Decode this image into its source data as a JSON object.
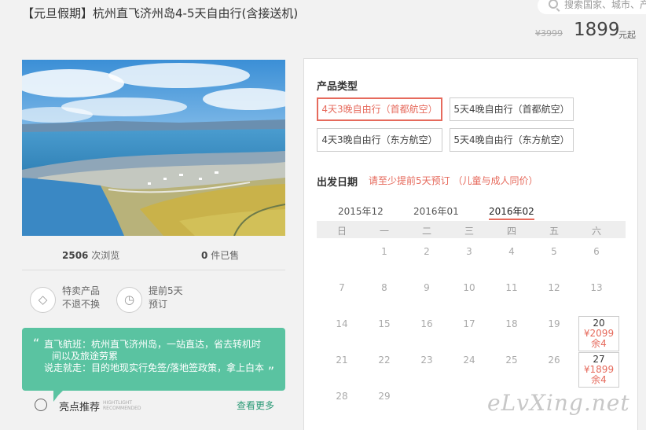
{
  "header": {
    "title": "【元旦假期】杭州直飞济州岛4-5天自由行(含接送机)",
    "search_placeholder": "搜索国家、城市、产",
    "old_price": "¥3999",
    "price": "1899",
    "price_unit": "元起"
  },
  "stats": {
    "views_count": "2506",
    "views_label": "次浏览",
    "sold_count": "0",
    "sold_label": "件已售"
  },
  "features": [
    {
      "icon": "tag-icon",
      "line1": "特卖产品",
      "line2": "不退不换"
    },
    {
      "icon": "clock-icon",
      "line1": "提前5天",
      "line2": "预订"
    }
  ],
  "highlight_box": {
    "line1": "直飞航班：杭州直飞济州岛，一站直达，省去转机时",
    "line2": "间以及旅途劳累",
    "line3": "说走就走：目的地现实行免签/落地签政策，拿上白本"
  },
  "highlight": {
    "label": "亮点推荐",
    "label_en_1": "HIGHTLIGHT",
    "label_en_2": "RECOMMENDED",
    "more": "查看更多"
  },
  "product": {
    "title": "产品类型",
    "options": [
      "4天3晚自由行（首都航空）",
      "5天4晚自由行（首都航空）",
      "4天3晚自由行（东方航空）",
      "5天4晚自由行（东方航空）"
    ]
  },
  "departure": {
    "title": "出发日期",
    "notice": "请至少提前5天预订 （儿童与成人同价）",
    "months": [
      "2015年12",
      "2016年01",
      "2016年02"
    ],
    "weekdays": [
      "日",
      "一",
      "二",
      "三",
      "四",
      "五",
      "六"
    ],
    "days": [
      "1",
      "2",
      "3",
      "4",
      "5",
      "6",
      "7",
      "8",
      "9",
      "10",
      "11",
      "12",
      "13",
      "14",
      "15",
      "16",
      "17",
      "18",
      "19",
      "21",
      "22",
      "23",
      "24",
      "25",
      "26",
      "28",
      "29"
    ],
    "priced": [
      {
        "day": "20",
        "price": "¥2099",
        "remain": "余4"
      },
      {
        "day": "27",
        "price": "¥1899",
        "remain": "余4"
      }
    ]
  },
  "watermark": "eLvXing.net",
  "colors": {
    "accent": "#e66a5c",
    "green": "#5ac3a1"
  }
}
